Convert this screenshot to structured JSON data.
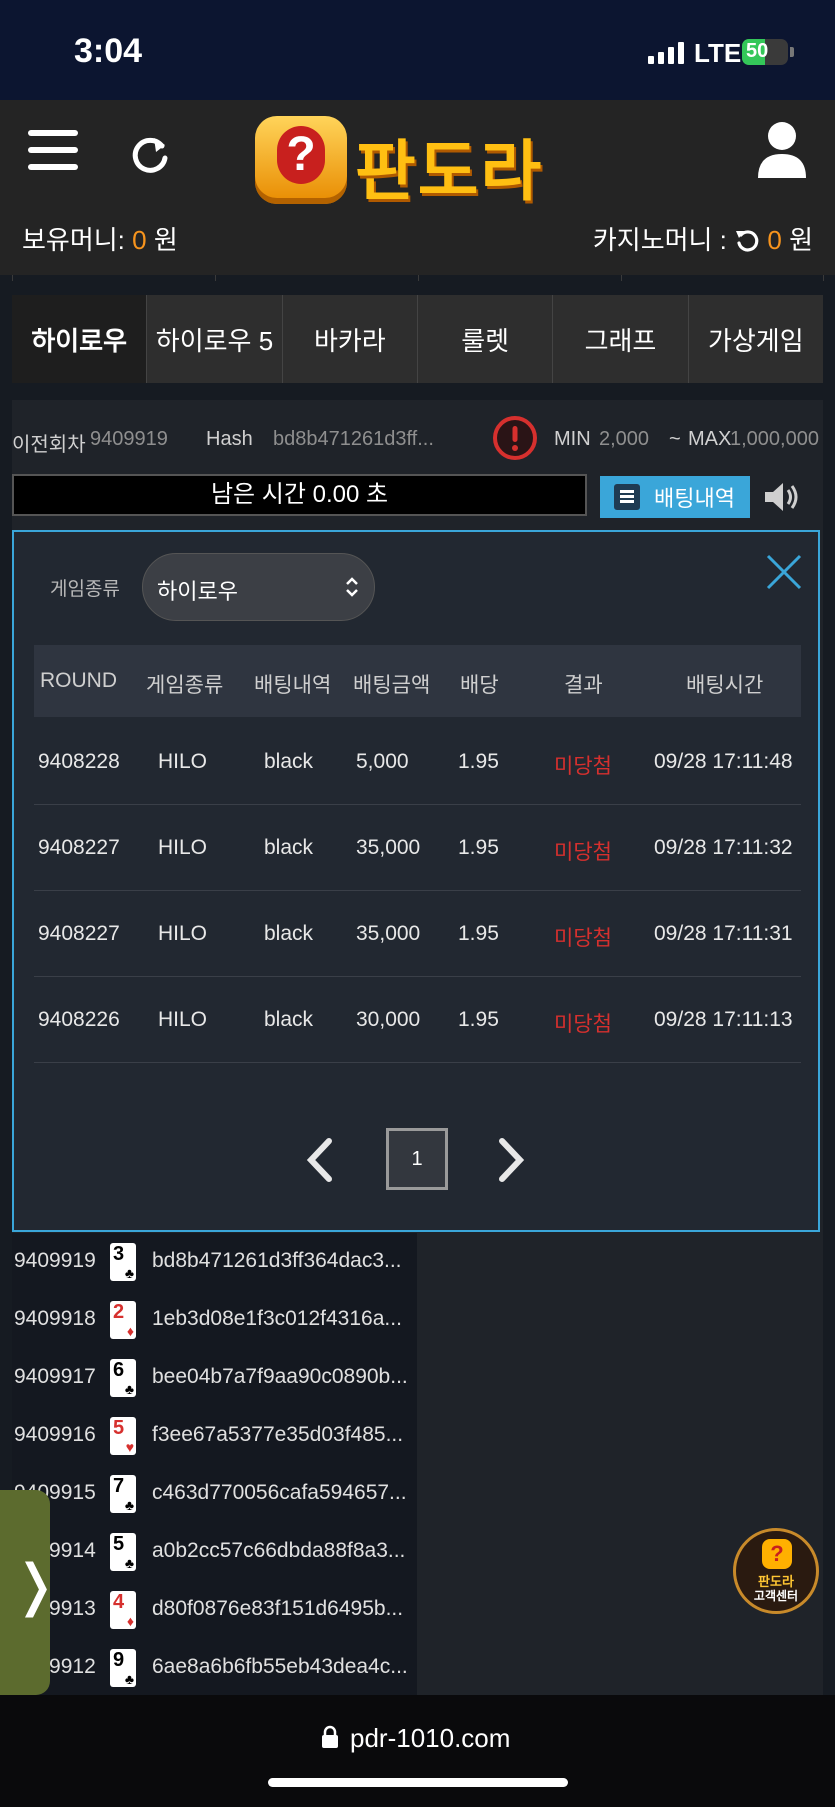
{
  "status_bar": {
    "time": "3:04",
    "network": "LTE",
    "battery": "50",
    "battery_level": 0.5
  },
  "header": {
    "logo_text": "판도라",
    "money_label": "보유머니: ",
    "money_value": "0",
    "money_unit": " 원",
    "casino_label": "카지노머니 : ",
    "casino_value": "0",
    "casino_unit": " 원"
  },
  "tabs": [
    "하이로우",
    "하이로우 5",
    "바카라",
    "룰렛",
    "그래프",
    "가상게임"
  ],
  "game_info": {
    "prev_round_label": "이전회차",
    "prev_round_value": "9409919",
    "hash_label": "Hash",
    "hash_value": "bd8b471261d3ff...",
    "min_label": "MIN",
    "min_value": "2,000",
    "range_sep": "~",
    "max_label": "MAX",
    "max_value": "1,000,000",
    "timer_text": "남은 시간 0.00 초",
    "bet_history_button": "배팅내역"
  },
  "modal": {
    "game_type_label": "게임종류",
    "game_type_selected": "하이로우",
    "columns": [
      "ROUND",
      "게임종류",
      "배팅내역",
      "배팅금액",
      "배당",
      "결과",
      "배팅시간"
    ],
    "rows": [
      [
        "9408228",
        "HILO",
        "black",
        "5,000",
        "1.95",
        "미당첨",
        "09/28 17:11:48"
      ],
      [
        "9408227",
        "HILO",
        "black",
        "35,000",
        "1.95",
        "미당첨",
        "09/28 17:11:32"
      ],
      [
        "9408227",
        "HILO",
        "black",
        "35,000",
        "1.95",
        "미당첨",
        "09/28 17:11:31"
      ],
      [
        "9408226",
        "HILO",
        "black",
        "30,000",
        "1.95",
        "미당첨",
        "09/28 17:11:13"
      ]
    ],
    "page": "1"
  },
  "history": [
    {
      "round": "9409919",
      "rank": "3",
      "suit": "♣",
      "color": "#000000",
      "hash": "bd8b471261d3ff364dac3..."
    },
    {
      "round": "9409918",
      "rank": "2",
      "suit": "♦",
      "color": "#d6302e",
      "hash": "1eb3d08e1f3c012f4316a..."
    },
    {
      "round": "9409917",
      "rank": "6",
      "suit": "♣",
      "color": "#000000",
      "hash": "bee04b7a7f9aa90c0890b..."
    },
    {
      "round": "9409916",
      "rank": "5",
      "suit": "♥",
      "color": "#d6302e",
      "hash": "f3ee67a5377e35d03f485..."
    },
    {
      "round": "9409915",
      "rank": "7",
      "suit": "♣",
      "color": "#000000",
      "hash": "c463d770056cafa594657..."
    },
    {
      "round": "9409914",
      "rank": "5",
      "suit": "♣",
      "color": "#000000",
      "hash": "a0b2cc57c66dbda88f8a3..."
    },
    {
      "round": "9409913",
      "rank": "4",
      "suit": "♦",
      "color": "#d6302e",
      "hash": "d80f0876e83f151d6495b..."
    },
    {
      "round": "9409912",
      "rank": "9",
      "suit": "♣",
      "color": "#000000",
      "hash": "6ae8a6b6fb55eb43dea4c..."
    }
  ],
  "side_tab_glyph": "❭",
  "customer_center": {
    "line1": "판도라",
    "line2": "고객센터"
  },
  "url": "pdr-1010.com",
  "colors": {
    "accent": "#3aa6d9",
    "money": "#f7941d",
    "lose": "#d6302e"
  }
}
